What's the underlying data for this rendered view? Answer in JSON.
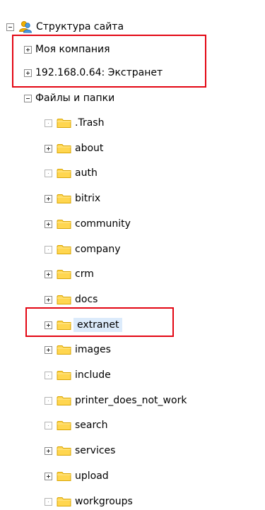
{
  "tree": {
    "root": {
      "label": "Структура сайта",
      "icon": "site-users-icon",
      "expanded": true
    },
    "sections": [
      {
        "label": "Моя компания",
        "expanded": false
      },
      {
        "label": "192.168.0.64: Экстранет",
        "expanded": false
      },
      {
        "label": "Файлы и папки",
        "expanded": true
      }
    ],
    "folders": [
      {
        "label": ".Trash",
        "expandable": false
      },
      {
        "label": "about",
        "expandable": true
      },
      {
        "label": "auth",
        "expandable": false
      },
      {
        "label": "bitrix",
        "expandable": true
      },
      {
        "label": "community",
        "expandable": true
      },
      {
        "label": "company",
        "expandable": false
      },
      {
        "label": "crm",
        "expandable": true
      },
      {
        "label": "docs",
        "expandable": true
      },
      {
        "label": "extranet",
        "expandable": true,
        "selected": true
      },
      {
        "label": "images",
        "expandable": true
      },
      {
        "label": "include",
        "expandable": false
      },
      {
        "label": "printer_does_not_work",
        "expandable": false
      },
      {
        "label": "search",
        "expandable": false
      },
      {
        "label": "services",
        "expandable": true
      },
      {
        "label": "upload",
        "expandable": true
      },
      {
        "label": "workgroups",
        "expandable": false
      }
    ]
  },
  "colors": {
    "highlight_border": "#e30613",
    "folder_fill": "#ffd650",
    "folder_stroke": "#d9a400",
    "selection_bg": "#dcebfb"
  }
}
